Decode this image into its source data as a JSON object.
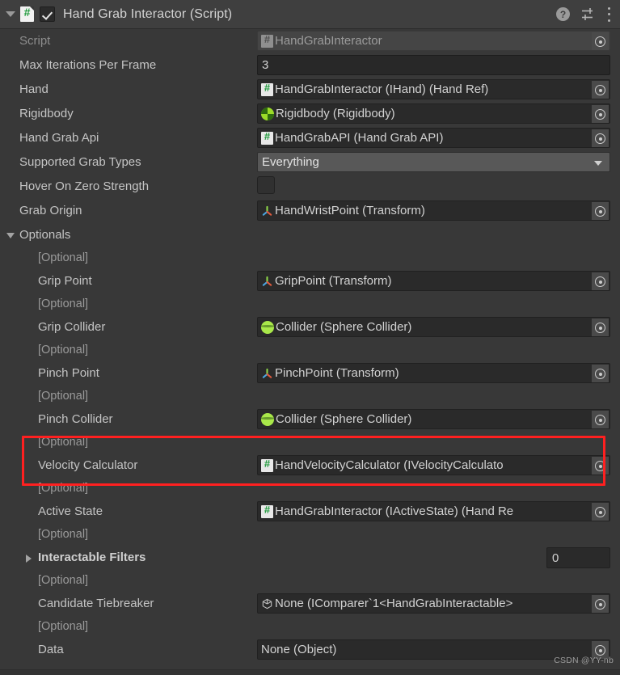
{
  "header": {
    "title": "Hand Grab Interactor (Script)",
    "enabled_checkbox": true,
    "foldout_expanded": true,
    "help_glyph": "?",
    "icons": [
      "script-icon",
      "help-icon",
      "preset-icon",
      "kebab-menu-icon"
    ]
  },
  "colors": {
    "background": "#383838",
    "header_background": "#3f3f3f",
    "field_background": "#2a2a2a",
    "popup_background": "#585858",
    "label": "#c4c4c4",
    "label_dim": "#8d8d8d",
    "annotation_red": "#ff2020",
    "script_icon_green": "#1f9a3c",
    "collider_green": "#a9e84a"
  },
  "fields": [
    {
      "label": "Script",
      "value": "HandGrabInteractor",
      "icon": "script-icon",
      "kind": "object",
      "disabled": true
    },
    {
      "label": "Max Iterations Per Frame",
      "value": "3",
      "kind": "number"
    },
    {
      "label": "Hand",
      "value": "HandGrabInteractor (IHand) (Hand Ref)",
      "icon": "script-icon",
      "kind": "object"
    },
    {
      "label": "Rigidbody",
      "value": "Rigidbody (Rigidbody)",
      "icon": "rigidbody-icon",
      "kind": "object"
    },
    {
      "label": "Hand Grab Api",
      "value": "HandGrabAPI (Hand Grab API)",
      "icon": "script-icon",
      "kind": "object"
    },
    {
      "label": "Supported Grab Types",
      "value": "Everything",
      "kind": "enum-popup"
    },
    {
      "label": "Hover On Zero Strength",
      "value": "",
      "kind": "toggle",
      "checked": false
    },
    {
      "label": "Grab Origin",
      "value": "HandWristPoint (Transform)",
      "icon": "transform-icon",
      "kind": "object"
    }
  ],
  "optionals_section": {
    "label": "Optionals",
    "expanded": true,
    "optional_tag": "[Optional]",
    "items": [
      {
        "label": "Grip Point",
        "value": "GripPoint (Transform)",
        "icon": "transform-icon",
        "kind": "object"
      },
      {
        "label": "Grip Collider",
        "value": "Collider (Sphere Collider)",
        "icon": "sphere-collider-icon",
        "kind": "object"
      },
      {
        "label": "Pinch Point",
        "value": "PinchPoint (Transform)",
        "icon": "transform-icon",
        "kind": "object"
      },
      {
        "label": "Pinch Collider",
        "value": "Collider (Sphere Collider)",
        "icon": "sphere-collider-icon",
        "kind": "object"
      },
      {
        "label": "Velocity Calculator",
        "value": "HandVelocityCalculator (IVelocityCalculato",
        "icon": "script-icon",
        "kind": "object",
        "highlighted": true
      },
      {
        "label": "Active State",
        "value": "HandGrabInteractor (IActiveState) (Hand Re",
        "icon": "script-icon",
        "kind": "object"
      },
      {
        "label": "Interactable Filters",
        "value": "0",
        "kind": "array-size",
        "bold": true,
        "foldout": "collapsed"
      },
      {
        "label": "Candidate Tiebreaker",
        "value": "None (IComparer`1<HandGrabInteractable>",
        "icon": "prefab-icon",
        "kind": "object"
      },
      {
        "label": "Data",
        "value": "None (Object)",
        "kind": "object-no-icon"
      }
    ]
  },
  "watermark": "CSDN @YY-nb"
}
